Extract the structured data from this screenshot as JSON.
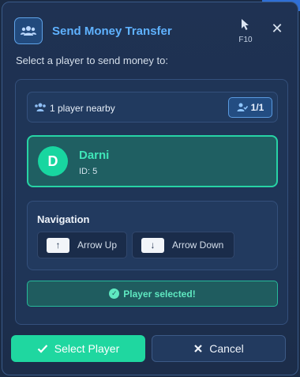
{
  "window": {
    "title": "Send Money Transfer",
    "cursor_hint_key": "F10",
    "close_label": "✕",
    "accent": "#5fb2ff",
    "success": "#1fd7a0"
  },
  "instruction": "Select a player to send money to:",
  "nearby": {
    "text": "1 player nearby",
    "count": "1/1"
  },
  "player": {
    "initial": "D",
    "name": "Darni",
    "id_text": "ID: 5"
  },
  "navigation": {
    "title": "Navigation",
    "up_key": "↑",
    "up_label": "Arrow Up",
    "down_key": "↓",
    "down_label": "Arrow Down"
  },
  "status": {
    "text": "Player selected!"
  },
  "actions": {
    "select_label": "Select Player",
    "cancel_label": "Cancel"
  }
}
